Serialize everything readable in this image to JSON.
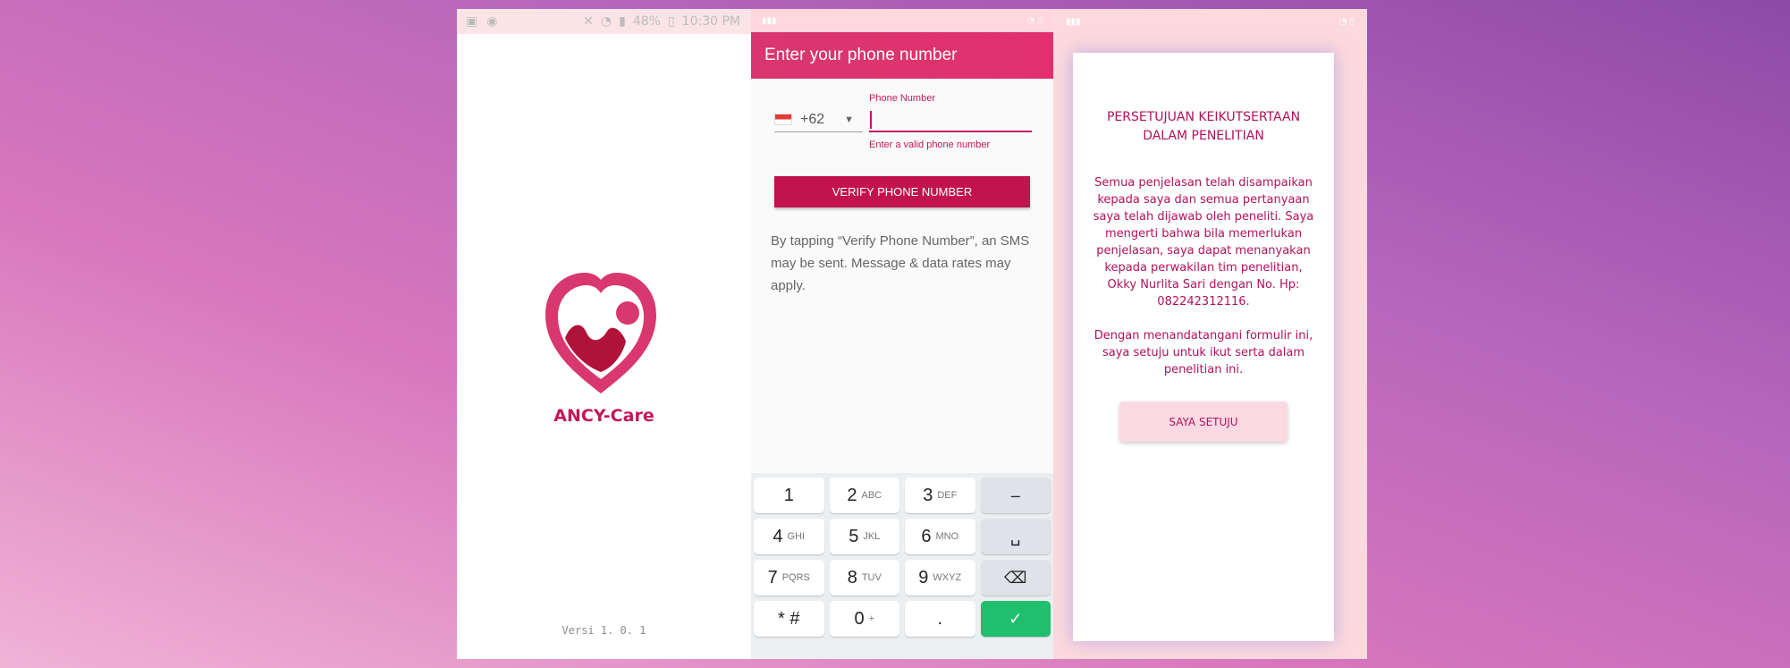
{
  "splash": {
    "status_time": "10:30 PM",
    "status_battery": "48%",
    "app_name": "ANCY-Care",
    "version": "Versi 1. 0. 1",
    "brand_color": "#d6336c",
    "brand_dark": "#b0123a"
  },
  "phone": {
    "title": "Enter your phone number",
    "country_code": "+62",
    "phone_label": "Phone Number",
    "phone_value": "",
    "error": "Enter a valid phone number",
    "verify_label": "VERIFY PHONE NUMBER",
    "note": "By tapping “Verify Phone Number”, an SMS may be sent. Message & data rates may apply.",
    "keyboard": [
      [
        {
          "d": "1",
          "l": ""
        },
        {
          "d": "2",
          "l": "ABC"
        },
        {
          "d": "3",
          "l": "DEF"
        },
        {
          "d": "–",
          "l": "",
          "fn": true
        }
      ],
      [
        {
          "d": "4",
          "l": "GHI"
        },
        {
          "d": "5",
          "l": "JKL"
        },
        {
          "d": "6",
          "l": "MNO"
        },
        {
          "d": "␣",
          "l": "",
          "fn": true
        }
      ],
      [
        {
          "d": "7",
          "l": "PQRS"
        },
        {
          "d": "8",
          "l": "TUV"
        },
        {
          "d": "9",
          "l": "WXYZ"
        },
        {
          "d": "⌫",
          "l": "",
          "fn": true
        }
      ],
      [
        {
          "d": "* #",
          "l": ""
        },
        {
          "d": "0",
          "l": "+"
        },
        {
          "d": ".",
          "l": ""
        },
        {
          "d": "✓",
          "l": "",
          "go": true
        }
      ]
    ]
  },
  "consent": {
    "title": "PERSETUJUAN KEIKUTSERTAAN DALAM PENELITIAN",
    "paragraph1": "Semua penjelasan telah disampaikan kepada saya dan semua pertanyaan saya telah dijawab oleh peneliti. Saya mengerti bahwa bila memerlukan penjelasan, saya dapat menanyakan kepada perwakilan tim penelitian, Okky Nurlita Sari dengan No. Hp: 082242312116.",
    "paragraph2": "Dengan menandatangani formulir ini, saya setuju untuk ikut serta dalam penelitian ini.",
    "agree_label": "SAYA SETUJU"
  }
}
